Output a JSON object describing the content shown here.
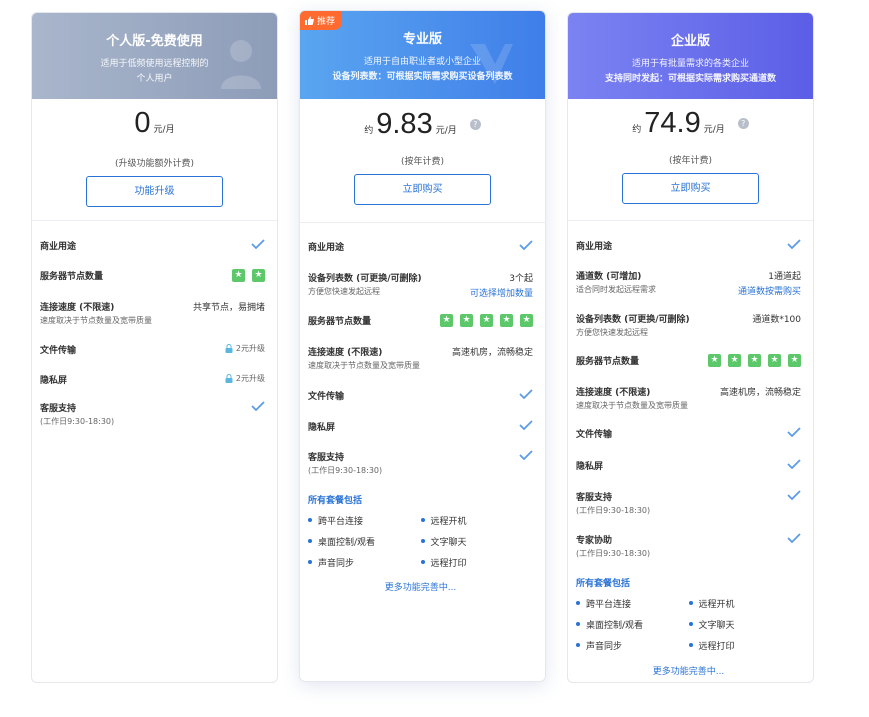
{
  "plans": {
    "personal": {
      "title": "个人版-免费使用",
      "desc1": "适用于低频使用远程控制的",
      "desc2": "个人用户",
      "price": "0",
      "unit": "元/月",
      "note": "(升级功能额外计费)",
      "cta": "功能升级",
      "features": {
        "commercial": "商业用途",
        "server_nodes": "服务器节点数量",
        "speed": "连接速度 (不限速)",
        "speed_sub": "速度取决于节点数量及宽带质量",
        "speed_val": "共享节点，易拥堵",
        "file": "文件传输",
        "file_val": "2元升级",
        "privacy": "隐私屏",
        "privacy_val": "2元升级",
        "support": "客服支持",
        "support_sub": "(工作日9:30-18:30)"
      }
    },
    "pro": {
      "badge": "推荐",
      "title": "专业版",
      "desc1": "适用于自由职业者或小型企业",
      "desc2": "设备列表数：可根据实际需求购买设备列表数",
      "approx": "约",
      "price": "9.83",
      "unit": "元/月",
      "help": "?",
      "note": "(按年计费)",
      "cta": "立即购买",
      "features": {
        "commercial": "商业用途",
        "devices": "设备列表数 (可更换/可删除)",
        "devices_sub": "方便您快速发起远程",
        "devices_val": "3个起",
        "devices_link": "可选择增加数量",
        "server_nodes": "服务器节点数量",
        "speed": "连接速度 (不限速)",
        "speed_sub": "速度取决于节点数量及宽带质量",
        "speed_val": "高速机房，流畅稳定",
        "file": "文件传输",
        "privacy": "隐私屏",
        "support": "客服支持",
        "support_sub": "(工作日9:30-18:30)"
      },
      "included_title": "所有套餐包括",
      "included": [
        "跨平台连接",
        "远程开机",
        "桌面控制/观看",
        "文字聊天",
        "声音同步",
        "远程打印"
      ],
      "more": "更多功能完善中..."
    },
    "enterprise": {
      "title": "企业版",
      "desc1": "适用于有批量需求的各类企业",
      "desc2": "支持同时发起：可根据实际需求购买通道数",
      "approx": "约",
      "price": "74.9",
      "unit": "元/月",
      "help": "?",
      "note": "(按年计费)",
      "cta": "立即购买",
      "features": {
        "commercial": "商业用途",
        "channels": "通道数 (可增加)",
        "channels_sub": "适合同时发起远程需求",
        "channels_val": "1通道起",
        "channels_link": "通道数按需购买",
        "devices": "设备列表数 (可更换/可删除)",
        "devices_sub": "方便您快速发起远程",
        "devices_val": "通道数*100",
        "server_nodes": "服务器节点数量",
        "speed": "连接速度 (不限速)",
        "speed_sub": "速度取决于节点数量及宽带质量",
        "speed_val": "高速机房，流畅稳定",
        "file": "文件传输",
        "privacy": "隐私屏",
        "support": "客服支持",
        "support_sub": "(工作日9:30-18:30)",
        "expert": "专家协助",
        "expert_sub": "(工作日9:30-18:30)"
      },
      "included_title": "所有套餐包括",
      "included": [
        "跨平台连接",
        "远程开机",
        "桌面控制/观看",
        "文字聊天",
        "声音同步",
        "远程打印"
      ],
      "more": "更多功能完善中..."
    }
  },
  "colors": {
    "accent": "#2a73d6",
    "star_green": "#5cc86a",
    "badge_orange": "#ff6a2e",
    "check_blue": "#5b9be8"
  },
  "icons": {
    "check": "check-icon",
    "star": "star-icon",
    "lock": "lock-icon",
    "help": "question-circle-icon",
    "thumb": "thumbs-up-icon"
  }
}
